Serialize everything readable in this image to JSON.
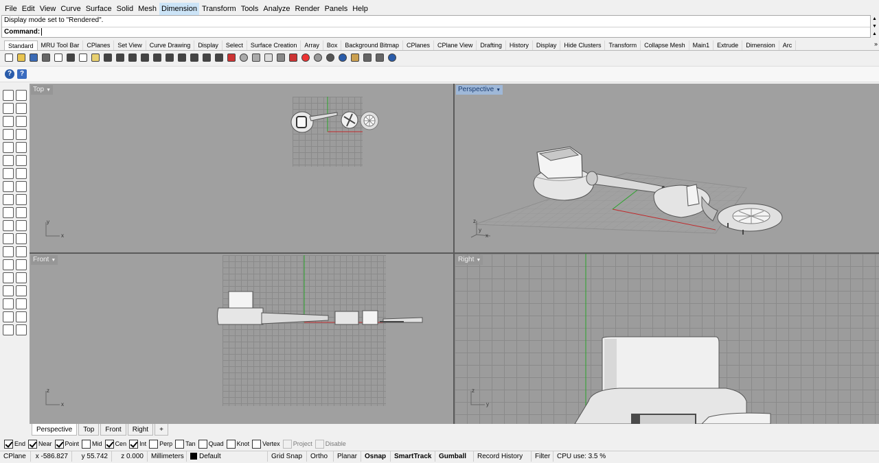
{
  "menu": {
    "items": [
      "File",
      "Edit",
      "View",
      "Curve",
      "Surface",
      "Solid",
      "Mesh",
      "Dimension",
      "Transform",
      "Tools",
      "Analyze",
      "Render",
      "Panels",
      "Help"
    ]
  },
  "command": {
    "history": "Display mode set to \"Rendered\".",
    "prompt": "Command:"
  },
  "toolbar_tabs": [
    "Standard",
    "MRU Tool Bar",
    "CPlanes",
    "Set View",
    "Curve Drawing",
    "Display",
    "Select",
    "Surface Creation",
    "Array",
    "Box",
    "Background Bitmap",
    "CPlanes",
    "CPlane View",
    "Drafting",
    "History",
    "Display",
    "Hide Clusters",
    "Transform",
    "Collapse Mesh",
    "Main1",
    "Extrude",
    "Dimension",
    "Arc"
  ],
  "toolbar_tabs_more": "»",
  "toolbar2": {
    "help1": "?",
    "help2": "?"
  },
  "viewports": {
    "top": {
      "label": "Top",
      "axis_y": "y",
      "axis_x": "x"
    },
    "perspective": {
      "label": "Perspective",
      "axis_z": "z",
      "axis_y": "y",
      "axis_x": "x"
    },
    "front": {
      "label": "Front",
      "axis_z": "z",
      "axis_x": "x"
    },
    "right": {
      "label": "Right",
      "axis_z": "z",
      "axis_y": "y"
    }
  },
  "viewport_tabs": [
    "Perspective",
    "Top",
    "Front",
    "Right"
  ],
  "viewport_tab_add": "+",
  "osnap": [
    {
      "label": "End",
      "checked": true
    },
    {
      "label": "Near",
      "checked": true
    },
    {
      "label": "Point",
      "checked": true
    },
    {
      "label": "Mid",
      "checked": false
    },
    {
      "label": "Cen",
      "checked": true
    },
    {
      "label": "Int",
      "checked": true
    },
    {
      "label": "Perp",
      "checked": false
    },
    {
      "label": "Tan",
      "checked": false
    },
    {
      "label": "Quad",
      "checked": false
    },
    {
      "label": "Knot",
      "checked": false
    },
    {
      "label": "Vertex",
      "checked": false
    },
    {
      "label": "Project",
      "checked": false,
      "disabled": true
    },
    {
      "label": "Disable",
      "checked": false,
      "disabled": true
    }
  ],
  "status": {
    "cplane": "CPlane",
    "x": "x -586.827",
    "y": "y 55.742",
    "z": "z 0.000",
    "units": "Millimeters",
    "layer": "Default",
    "grid_snap": "Grid Snap",
    "ortho": "Ortho",
    "planar": "Planar",
    "osnap": "Osnap",
    "smarttrack": "SmartTrack",
    "gumball": "Gumball",
    "record_history": "Record History",
    "filter": "Filter",
    "cpu": "CPU use: 3.5 %"
  }
}
